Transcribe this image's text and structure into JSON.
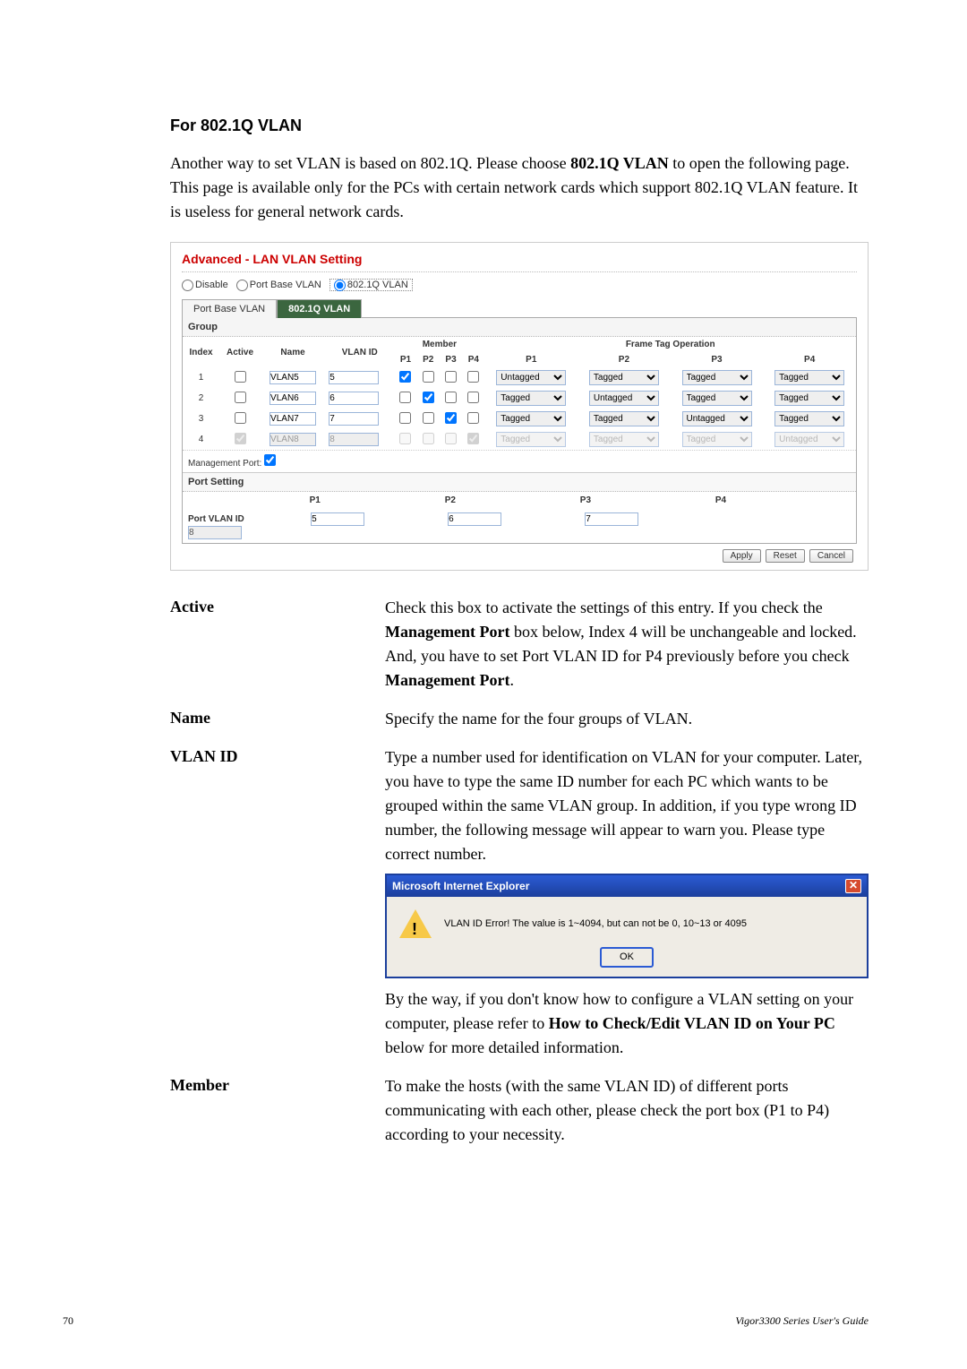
{
  "section_title": "For 802.1Q VLAN",
  "intro": {
    "part1": "Another way to set VLAN is based on 802.1Q. Please choose ",
    "bold1": "802.1Q VLAN",
    "part2": " to open the following page. This page is available only for the PCs with certain network cards which support 802.1Q VLAN feature. It is useless for general network cards."
  },
  "ui": {
    "panel_title": "Advanced - LAN VLAN Setting",
    "modes": {
      "disable": "Disable",
      "portbase": "Port Base VLAN",
      "dot1q": "802.1Q VLAN"
    },
    "tabs": {
      "portbase": "Port Base VLAN",
      "dot1q": "802.1Q VLAN"
    },
    "group_label": "Group",
    "headers": {
      "index": "Index",
      "active": "Active",
      "name": "Name",
      "vlanid": "VLAN ID",
      "member": "Member",
      "p1": "P1",
      "p2": "P2",
      "p3": "P3",
      "p4": "P4",
      "fto": "Frame Tag Operation"
    },
    "rows": [
      {
        "index": "1",
        "name": "VLAN5",
        "vlanid": "5",
        "mem": [
          true,
          false,
          false,
          false
        ],
        "fto": [
          "Untagged",
          "Tagged",
          "Tagged",
          "Tagged"
        ],
        "active": false,
        "disabled": false
      },
      {
        "index": "2",
        "name": "VLAN6",
        "vlanid": "6",
        "mem": [
          false,
          true,
          false,
          false
        ],
        "fto": [
          "Tagged",
          "Untagged",
          "Tagged",
          "Tagged"
        ],
        "active": false,
        "disabled": false
      },
      {
        "index": "3",
        "name": "VLAN7",
        "vlanid": "7",
        "mem": [
          false,
          false,
          true,
          false
        ],
        "fto": [
          "Tagged",
          "Tagged",
          "Untagged",
          "Tagged"
        ],
        "active": false,
        "disabled": false
      },
      {
        "index": "4",
        "name": "VLAN8",
        "vlanid": "8",
        "mem": [
          false,
          false,
          false,
          true
        ],
        "fto": [
          "Tagged",
          "Tagged",
          "Tagged",
          "Untagged"
        ],
        "active": true,
        "disabled": true
      }
    ],
    "mgmt_label": "Management Port:",
    "port_setting_label": "Port Setting",
    "port_vlanid_label": "Port VLAN ID",
    "port_vlanid": {
      "p1": "5",
      "p2": "6",
      "p3": "7",
      "p4": "8"
    },
    "buttons": {
      "apply": "Apply",
      "reset": "Reset",
      "cancel": "Cancel"
    }
  },
  "defs": {
    "active": {
      "term": "Active",
      "d1": "Check this box to activate the settings of this entry. If you check the ",
      "b1": "Management Port",
      "d2": " box below, Index 4 will be unchangeable and locked. And, you have to set Port VLAN ID for P4 previously before you check ",
      "b2": "Management Port",
      "d3": "."
    },
    "name": {
      "term": "Name",
      "d": "Specify the name for the four groups of VLAN."
    },
    "vlanid": {
      "term": "VLAN ID",
      "d1": "Type a number used for identification on VLAN for your computer. Later, you have to type the same ID number for each PC which wants to be grouped within the same VLAN group. In addition, if you type wrong ID number, the following message will appear to warn you. Please type correct number.",
      "dlg_title": "Microsoft Internet Explorer",
      "dlg_msg": "VLAN ID Error!  The value is 1~4094, but can not be 0, 10~13 or 4095",
      "dlg_ok": "OK",
      "d2a": "By the way, if you don't know how to configure a VLAN setting on your computer, please refer to ",
      "d2b": "How to Check/Edit VLAN ID on Your PC",
      "d2c": " below for more detailed information."
    },
    "member": {
      "term": "Member",
      "d": "To make the hosts (with the same VLAN ID) of different ports communicating with each other, please check the port box (P1 to P4) according to your necessity."
    }
  },
  "footer": {
    "page": "70",
    "guide": "Vigor3300  Series  User's Guide"
  }
}
